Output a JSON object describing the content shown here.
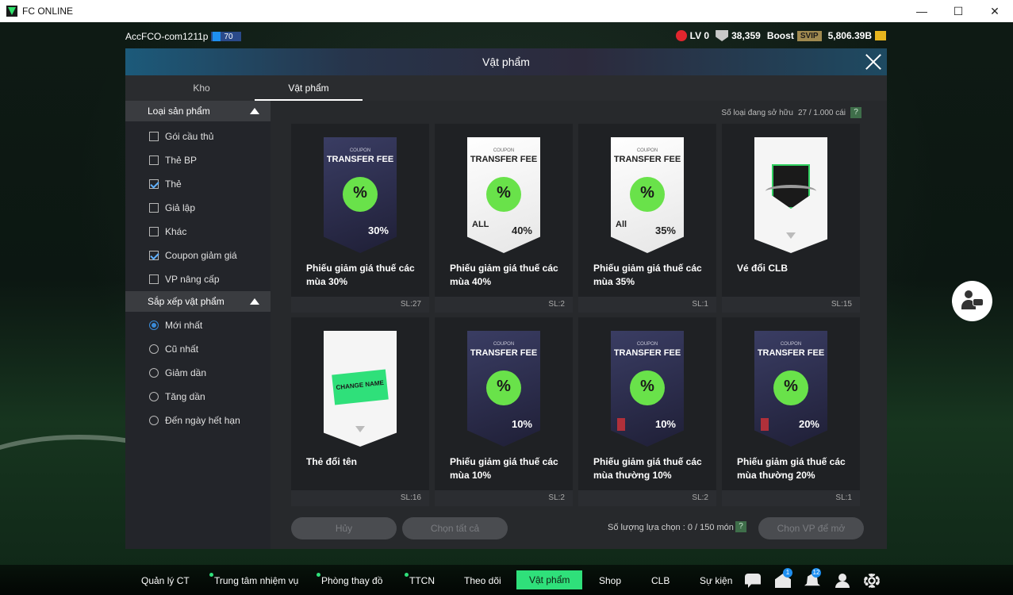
{
  "window": {
    "title": "FC ONLINE",
    "minimize": "—",
    "maximize": "☐",
    "close": "✕"
  },
  "topbar": {
    "account": "AccFCO-com1211p",
    "level": "70",
    "lv": "LV 0",
    "shield_count": "38,359",
    "boost_label": "Boost",
    "svip": "SVIP",
    "balance": "5,806.39B"
  },
  "dialog": {
    "title": "Vật phẩm",
    "tabs": [
      {
        "label": "Kho"
      },
      {
        "label": "Vật phẩm"
      }
    ],
    "owned_label": "Số loại đang sở hữu",
    "owned_value": "27 / 1.000 cái",
    "help": "?"
  },
  "sidebar": {
    "product_type": {
      "title": "Loại sản phẩm",
      "options": [
        {
          "label": "Gói cầu thủ",
          "checked": false
        },
        {
          "label": "Thẻ BP",
          "checked": false
        },
        {
          "label": "Thẻ",
          "checked": true
        },
        {
          "label": "Giả lập",
          "checked": false
        },
        {
          "label": "Khác",
          "checked": false
        },
        {
          "label": "Coupon giảm giá",
          "checked": true
        },
        {
          "label": "VP nâng cấp",
          "checked": false
        }
      ]
    },
    "sort": {
      "title": "Sắp xếp vật phẩm",
      "options": [
        {
          "label": "Mới nhất",
          "checked": true
        },
        {
          "label": "Cũ nhất",
          "checked": false
        },
        {
          "label": "Giảm dần",
          "checked": false
        },
        {
          "label": "Tăng dần",
          "checked": false
        },
        {
          "label": "Đến ngày hết hạn",
          "checked": false
        }
      ]
    }
  },
  "items": [
    {
      "name": "Phiếu giảm giá thuế các mùa 30%",
      "count": "SL:27",
      "kind": "coupon-dark",
      "coupon_small": "COUPON",
      "coupon_title": "TRANSFER FEE",
      "value": "30%",
      "all": ""
    },
    {
      "name": "Phiếu giảm giá thuế các mùa 40%",
      "count": "SL:2",
      "kind": "coupon-light",
      "coupon_small": "COUPON",
      "coupon_title": "TRANSFER FEE",
      "value": "40%",
      "all": "ALL"
    },
    {
      "name": "Phiếu giảm giá thuế các mùa 35%",
      "count": "SL:1",
      "kind": "coupon-light",
      "coupon_small": "COUPON",
      "coupon_title": "TRANSFER FEE",
      "value": "35%",
      "all": "All"
    },
    {
      "name": "Vé đổi CLB",
      "count": "SL:15",
      "kind": "club",
      "coupon_small": "",
      "coupon_title": "",
      "value": "",
      "all": ""
    },
    {
      "name": "Thẻ đổi tên",
      "count": "SL:16",
      "kind": "rename",
      "coupon_small": "",
      "coupon_title": "",
      "value": "",
      "all": "",
      "ticket": "CHANGE NAME"
    },
    {
      "name": "Phiếu giảm giá thuế các mùa 10%",
      "count": "SL:2",
      "kind": "coupon-dark",
      "coupon_small": "COUPON",
      "coupon_title": "TRANSFER FEE",
      "value": "10%",
      "all": ""
    },
    {
      "name": "Phiếu giảm giá thuế các mùa thường 10%",
      "count": "SL:2",
      "kind": "coupon-dark-lock",
      "coupon_small": "COUPON",
      "coupon_title": "TRANSFER FEE",
      "value": "10%",
      "all": ""
    },
    {
      "name": "Phiếu giảm giá thuế các mùa thường 20%",
      "count": "SL:1",
      "kind": "coupon-dark-lock",
      "coupon_small": "COUPON",
      "coupon_title": "TRANSFER FEE",
      "value": "20%",
      "all": ""
    }
  ],
  "footer": {
    "cancel": "Hủy",
    "select_all": "Chọn tất cả",
    "selected_label": "Số lượng lựa chọn : 0 / 150 món",
    "open_selected": "Chọn VP để mở"
  },
  "navbar": {
    "items": [
      {
        "label": "Quản lý CT",
        "dot": false
      },
      {
        "label": "Trung tâm nhiệm vụ",
        "dot": true
      },
      {
        "label": "Phòng thay đồ",
        "dot": true
      },
      {
        "label": "TTCN",
        "dot": true
      },
      {
        "label": "Theo dõi",
        "dot": false
      },
      {
        "label": "Vật phẩm",
        "dot": false,
        "active": true
      },
      {
        "label": "Shop",
        "dot": false
      },
      {
        "label": "CLB",
        "dot": false
      },
      {
        "label": "Sự kiện",
        "dot": false
      }
    ],
    "mail_badge": "1",
    "bell_badge": "12"
  },
  "colors": {
    "accent": "#2fe07a",
    "coupon_badge": "#69e24a",
    "link_blue": "#1e8ff0"
  }
}
